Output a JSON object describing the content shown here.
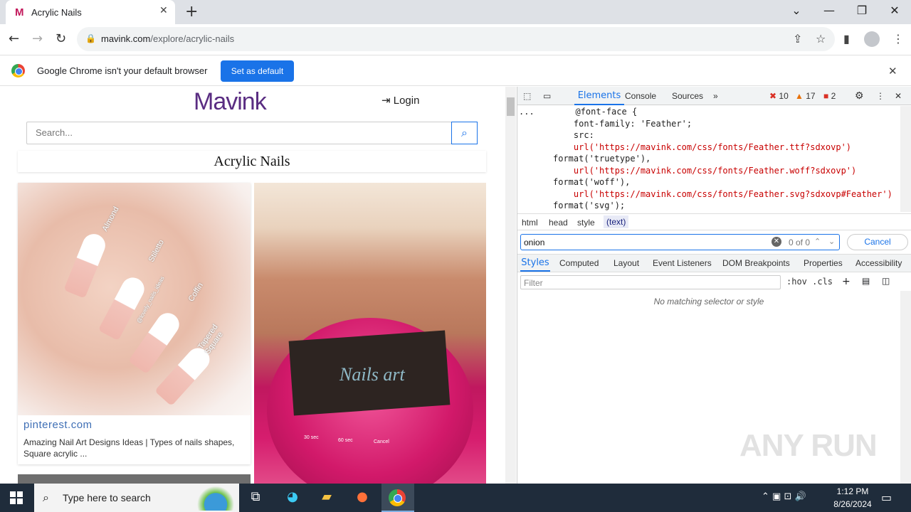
{
  "browser": {
    "tab_favicon": "M",
    "tab_title": "Acrylic Nails",
    "tab_close": "✕",
    "new_tab": "+",
    "window_controls": {
      "dropdown": "⌄",
      "minimize": "—",
      "restore": "❐",
      "close": "✕"
    },
    "nav": {
      "back": "←",
      "forward": "→",
      "reload": "↻"
    },
    "url_host": "mavink.com",
    "url_path": "/explore/acrylic-nails",
    "toolbar_icons": [
      "share-icon",
      "star-icon",
      "sidepanel-icon",
      "profile-icon",
      "menu-icon"
    ]
  },
  "infobar": {
    "text": "Google Chrome isn't your default browser",
    "button": "Set as default",
    "close": "✕"
  },
  "page": {
    "logo": "Mavink",
    "login": "Login",
    "search_placeholder": "Search...",
    "heading": "Acrylic Nails",
    "card1": {
      "labels": [
        "Almond",
        "Stiletto",
        "Coffin",
        "Tapered Square",
        "@lovely_nails_ideas"
      ],
      "source": "pinterest.com",
      "caption": "Amazing Nail Art Designs Ideas | Types of nails shapes, Square acrylic ..."
    },
    "card2": {
      "image_text": "Nails art",
      "lamp_labels": [
        "30 sec",
        "60 sec",
        "Cancel"
      ]
    }
  },
  "devtools": {
    "tabs": [
      "Elements",
      "Console",
      "Sources",
      "»"
    ],
    "errors": "10",
    "warnings": "17",
    "issues": "2",
    "code_lines": [
      "@font-face {",
      "    font-family: 'Feather';",
      "    src:",
      "    url('https://mavink.com/css/fonts/Feather.ttf?sdxovp')",
      "format('truetype'),",
      "    url('https://mavink.com/css/fonts/Feather.woff?sdxovp')",
      "format('woff'),",
      "    url('https://mavink.com/css/fonts/Feather.svg?sdxovp#Feather')",
      "format('svg');"
    ],
    "code_ellipsis": "...",
    "breadcrumbs": [
      "html",
      "head",
      "style",
      "(text)"
    ],
    "find": {
      "value": "onion",
      "count": "0 of 0",
      "cancel": "Cancel"
    },
    "style_tabs": [
      "Styles",
      "Computed",
      "Layout",
      "Event Listeners",
      "DOM Breakpoints",
      "Properties",
      "Accessibility"
    ],
    "filter_placeholder": "Filter",
    "filter_tools": ":hov  .cls",
    "no_match": "No matching selector or style",
    "watermark": "ANY RUN"
  },
  "taskbar": {
    "search_text": "Type here to search",
    "time": "1:12 PM",
    "date": "8/26/2024",
    "apps": [
      "task-view-icon",
      "edge-icon",
      "file-explorer-icon",
      "firefox-icon",
      "chrome-icon"
    ]
  },
  "colors": {
    "accent": "#1a73e8",
    "brand": "#5a2d82",
    "brand_mark": "#e91e63",
    "taskbar": "#1f2c3b"
  }
}
